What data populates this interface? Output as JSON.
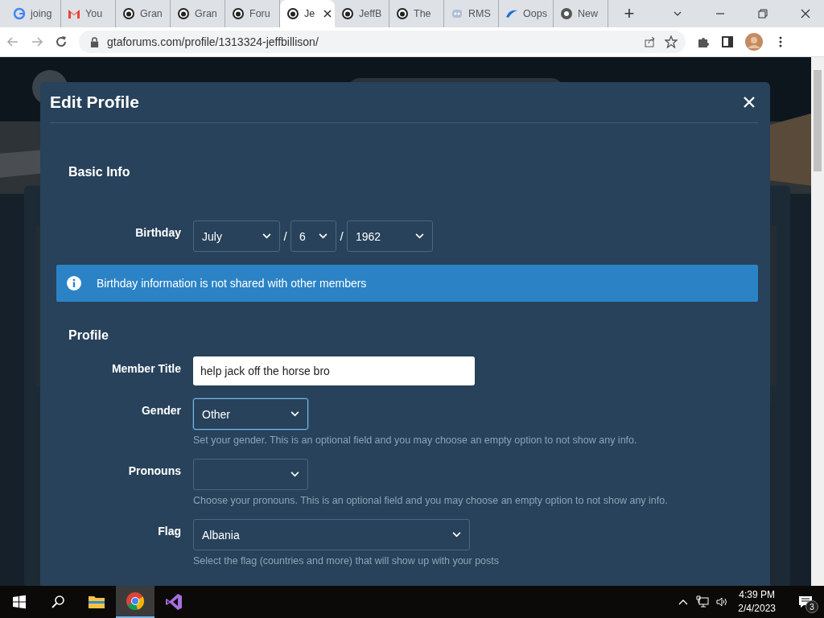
{
  "browser": {
    "tabs": [
      {
        "label": "joing",
        "kind": "google",
        "selected": false
      },
      {
        "label": "You",
        "kind": "mail",
        "selected": false
      },
      {
        "label": "Gran",
        "kind": "forum",
        "selected": false
      },
      {
        "label": "Gran",
        "kind": "forum",
        "selected": false
      },
      {
        "label": "Foru",
        "kind": "forum",
        "selected": false
      },
      {
        "label": "Je",
        "kind": "forum",
        "selected": true
      },
      {
        "label": "JeffB",
        "kind": "forum",
        "selected": false
      },
      {
        "label": "The",
        "kind": "forum",
        "selected": false
      },
      {
        "label": "RMS",
        "kind": "mask",
        "selected": false
      },
      {
        "label": "Oops",
        "kind": "wave",
        "selected": false
      },
      {
        "label": "New",
        "kind": "chrome",
        "selected": false
      }
    ],
    "new_tab": "+",
    "address": "gtaforums.com/profile/1313324-jeffbillison/"
  },
  "modal": {
    "title": "Edit Profile",
    "basic_info": {
      "heading": "Basic Info",
      "birthday": {
        "label": "Birthday",
        "parts": [
          {
            "value": "July"
          },
          {
            "value": "6"
          },
          {
            "value": "1962"
          }
        ],
        "separators": [
          "/",
          "/"
        ]
      },
      "notice": "Birthday information is not shared with other members"
    },
    "profile": {
      "heading": "Profile",
      "fields": [
        {
          "kind": "text",
          "label": "Member Title",
          "value": "help jack off the horse bro",
          "focused": false
        },
        {
          "kind": "select",
          "label": "Gender",
          "value": "Other",
          "focused": true,
          "help": "Set your gender. This is an optional field and you may choose an empty option to not show any info."
        },
        {
          "kind": "select",
          "label": "Pronouns",
          "focused": false,
          "help": "Choose your pronouns. This is an optional field and you may choose an empty option to not show any info."
        },
        {
          "kind": "wide-select",
          "label": "Flag",
          "value": "Albania",
          "focused": false,
          "help": "Select the flag (countries and more) that will show up with your posts"
        }
      ]
    }
  },
  "taskbar": {
    "apps": [
      {
        "kind": "folder",
        "selected": false
      },
      {
        "kind": "chrome",
        "selected": true
      },
      {
        "kind": "studio",
        "selected": false
      }
    ],
    "time": "4:39 PM",
    "date": "2/4/2023",
    "notifications": "3"
  }
}
